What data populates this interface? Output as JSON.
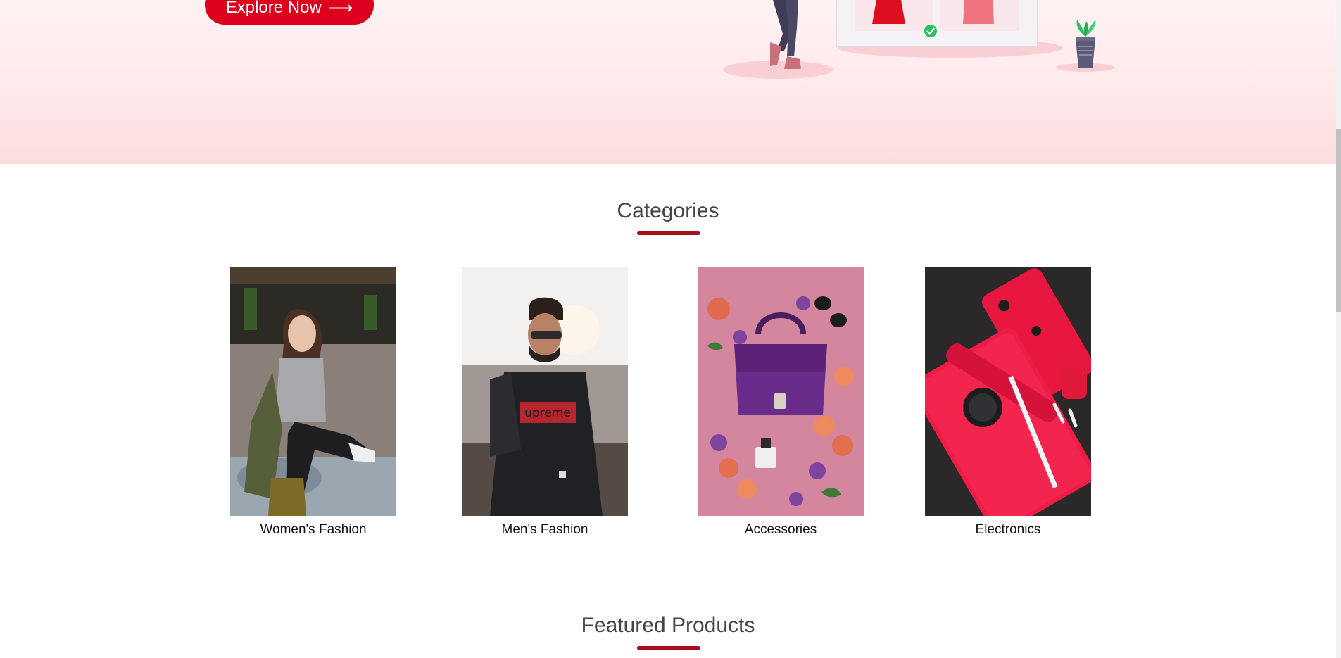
{
  "hero": {
    "cta_label": "Explore Now",
    "cta_arrow": "⟶"
  },
  "categories": {
    "title": "Categories",
    "items": [
      {
        "label": "Women's Fashion"
      },
      {
        "label": "Men's Fashion"
      },
      {
        "label": "Accessories"
      },
      {
        "label": "Electronics"
      }
    ]
  },
  "featured": {
    "title": "Featured Products"
  },
  "colors": {
    "brand_red": "#dc001c",
    "underline": "#a6101c",
    "hero_bg": "#ffe9eb"
  }
}
